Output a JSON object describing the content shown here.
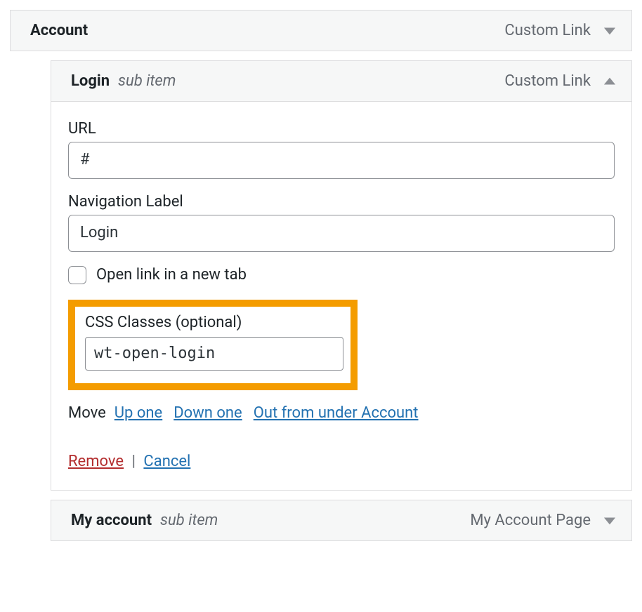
{
  "items": [
    {
      "title": "Account",
      "subtitle": "",
      "type": "Custom Link",
      "expanded": false,
      "sub": false
    },
    {
      "title": "Login",
      "subtitle": "sub item",
      "type": "Custom Link",
      "expanded": true,
      "sub": true,
      "fields": {
        "url_label": "URL",
        "url_value": "#",
        "nav_label_label": "Navigation Label",
        "nav_label_value": "Login",
        "new_tab_label": "Open link in a new tab",
        "css_label": "CSS Classes (optional)",
        "css_value": "wt-open-login"
      },
      "move": {
        "label": "Move",
        "up": "Up one",
        "down": "Down one",
        "out": "Out from under Account"
      },
      "actions": {
        "remove": "Remove",
        "cancel": "Cancel"
      }
    },
    {
      "title": "My account",
      "subtitle": "sub item",
      "type": "My Account Page",
      "expanded": false,
      "sub": true
    }
  ]
}
